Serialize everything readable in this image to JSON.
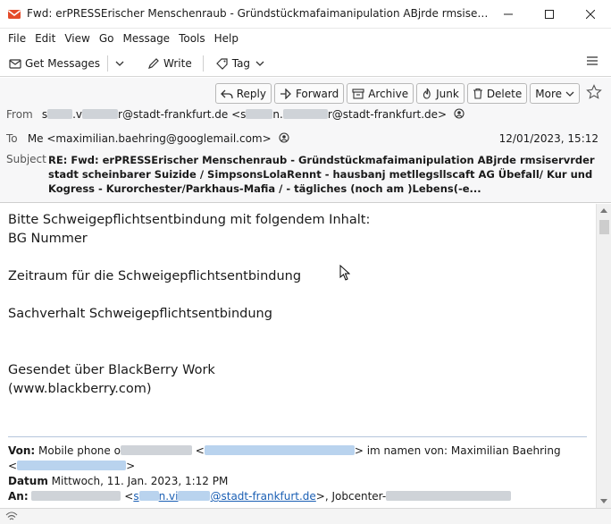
{
  "window": {
    "title": "Fwd: erPRESSErischer Menschenraub - Gründstückmafaimanipulation ABjrde rmsiservrder stadt ...",
    "minimize_icon": "minimize-icon",
    "maximize_icon": "maximize-icon",
    "close_icon": "close-icon"
  },
  "menubar": {
    "items": [
      "File",
      "Edit",
      "View",
      "Go",
      "Message",
      "Tools",
      "Help"
    ]
  },
  "toolbar": {
    "get_messages": "Get Messages",
    "write": "Write",
    "tag": "Tag"
  },
  "actions": {
    "reply": "Reply",
    "forward": "Forward",
    "archive": "Archive",
    "junk": "Junk",
    "delete": "Delete",
    "more": "More"
  },
  "header": {
    "from_label": "From",
    "from_fragment_1": "s",
    "from_fragment_2": ".v",
    "from_fragment_3": "r@stadt-frankfurt.de <s",
    "from_fragment_4": "n.",
    "from_fragment_5": "r@stadt-frankfurt.de>",
    "to_label": "To",
    "to_value": "Me <maximilian.baehring@googlemail.com>",
    "date": "12/01/2023, 15:12",
    "subject_label": "Subject",
    "subject": "RE: Fwd: erPRESSErischer Menschenraub - Gründstückmafaimanipulation ABjrde rmsiservrder stadt scheinbarer Suizide / SimpsonsLolaRennt - hausbanj metllegsllscaft AG Übefall/ Kur und Kogress - Kurorchester/Parkhaus-Mafia / - tägliches (noch am )Lebens(-e..."
  },
  "body": {
    "line1": "Bitte Schweigepflichtsentbindung mit folgendem Inhalt:",
    "line2": "BG Nummer",
    "line3": "Zeitraum für die Schweigepflichtsentbindung",
    "line4": "Sachverhalt Schweigepflichtsentbindung",
    "line5": "Gesendet über BlackBerry Work",
    "line6": "(www.blackberry.com)"
  },
  "quote": {
    "von_label": "Von:",
    "von_text": "Mobile phone o",
    "von_lt": "<",
    "von_rest": "> im namen von: Maximilian Baehring",
    "von_line2_lt": "<",
    "von_line2_gt": ">",
    "datum_label": "Datum",
    "datum_value": "Mittwoch, 11. Jan. 2023, 1:12 PM",
    "an_label": "An:",
    "an_lt": "<",
    "an_link_1": "s",
    "an_link_2": "n.vi",
    "an_link_3": "@stadt-frankfurt.de",
    "an_rest": ">, Jobcenter-"
  }
}
